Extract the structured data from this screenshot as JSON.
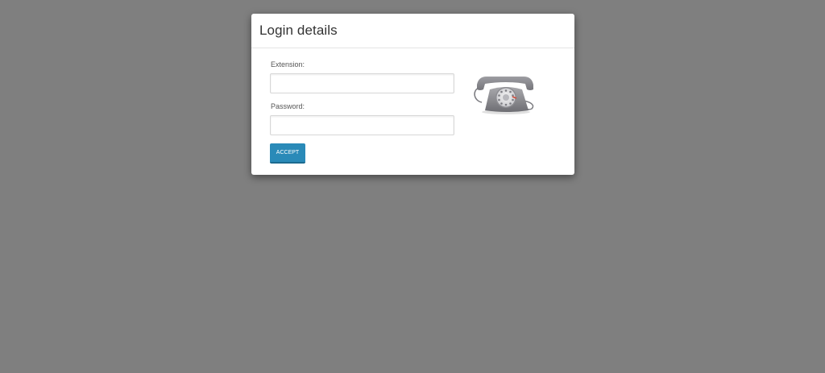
{
  "modal": {
    "title": "Login details"
  },
  "form": {
    "extension": {
      "label": "Extension:",
      "value": "",
      "placeholder": ""
    },
    "password": {
      "label": "Password:",
      "value": "",
      "placeholder": ""
    },
    "accept_label": "ACCEPT"
  },
  "icons": {
    "phone": "rotary-telephone-icon"
  },
  "colors": {
    "background": "#7f7f7f",
    "accent": "#2a8ab8"
  }
}
